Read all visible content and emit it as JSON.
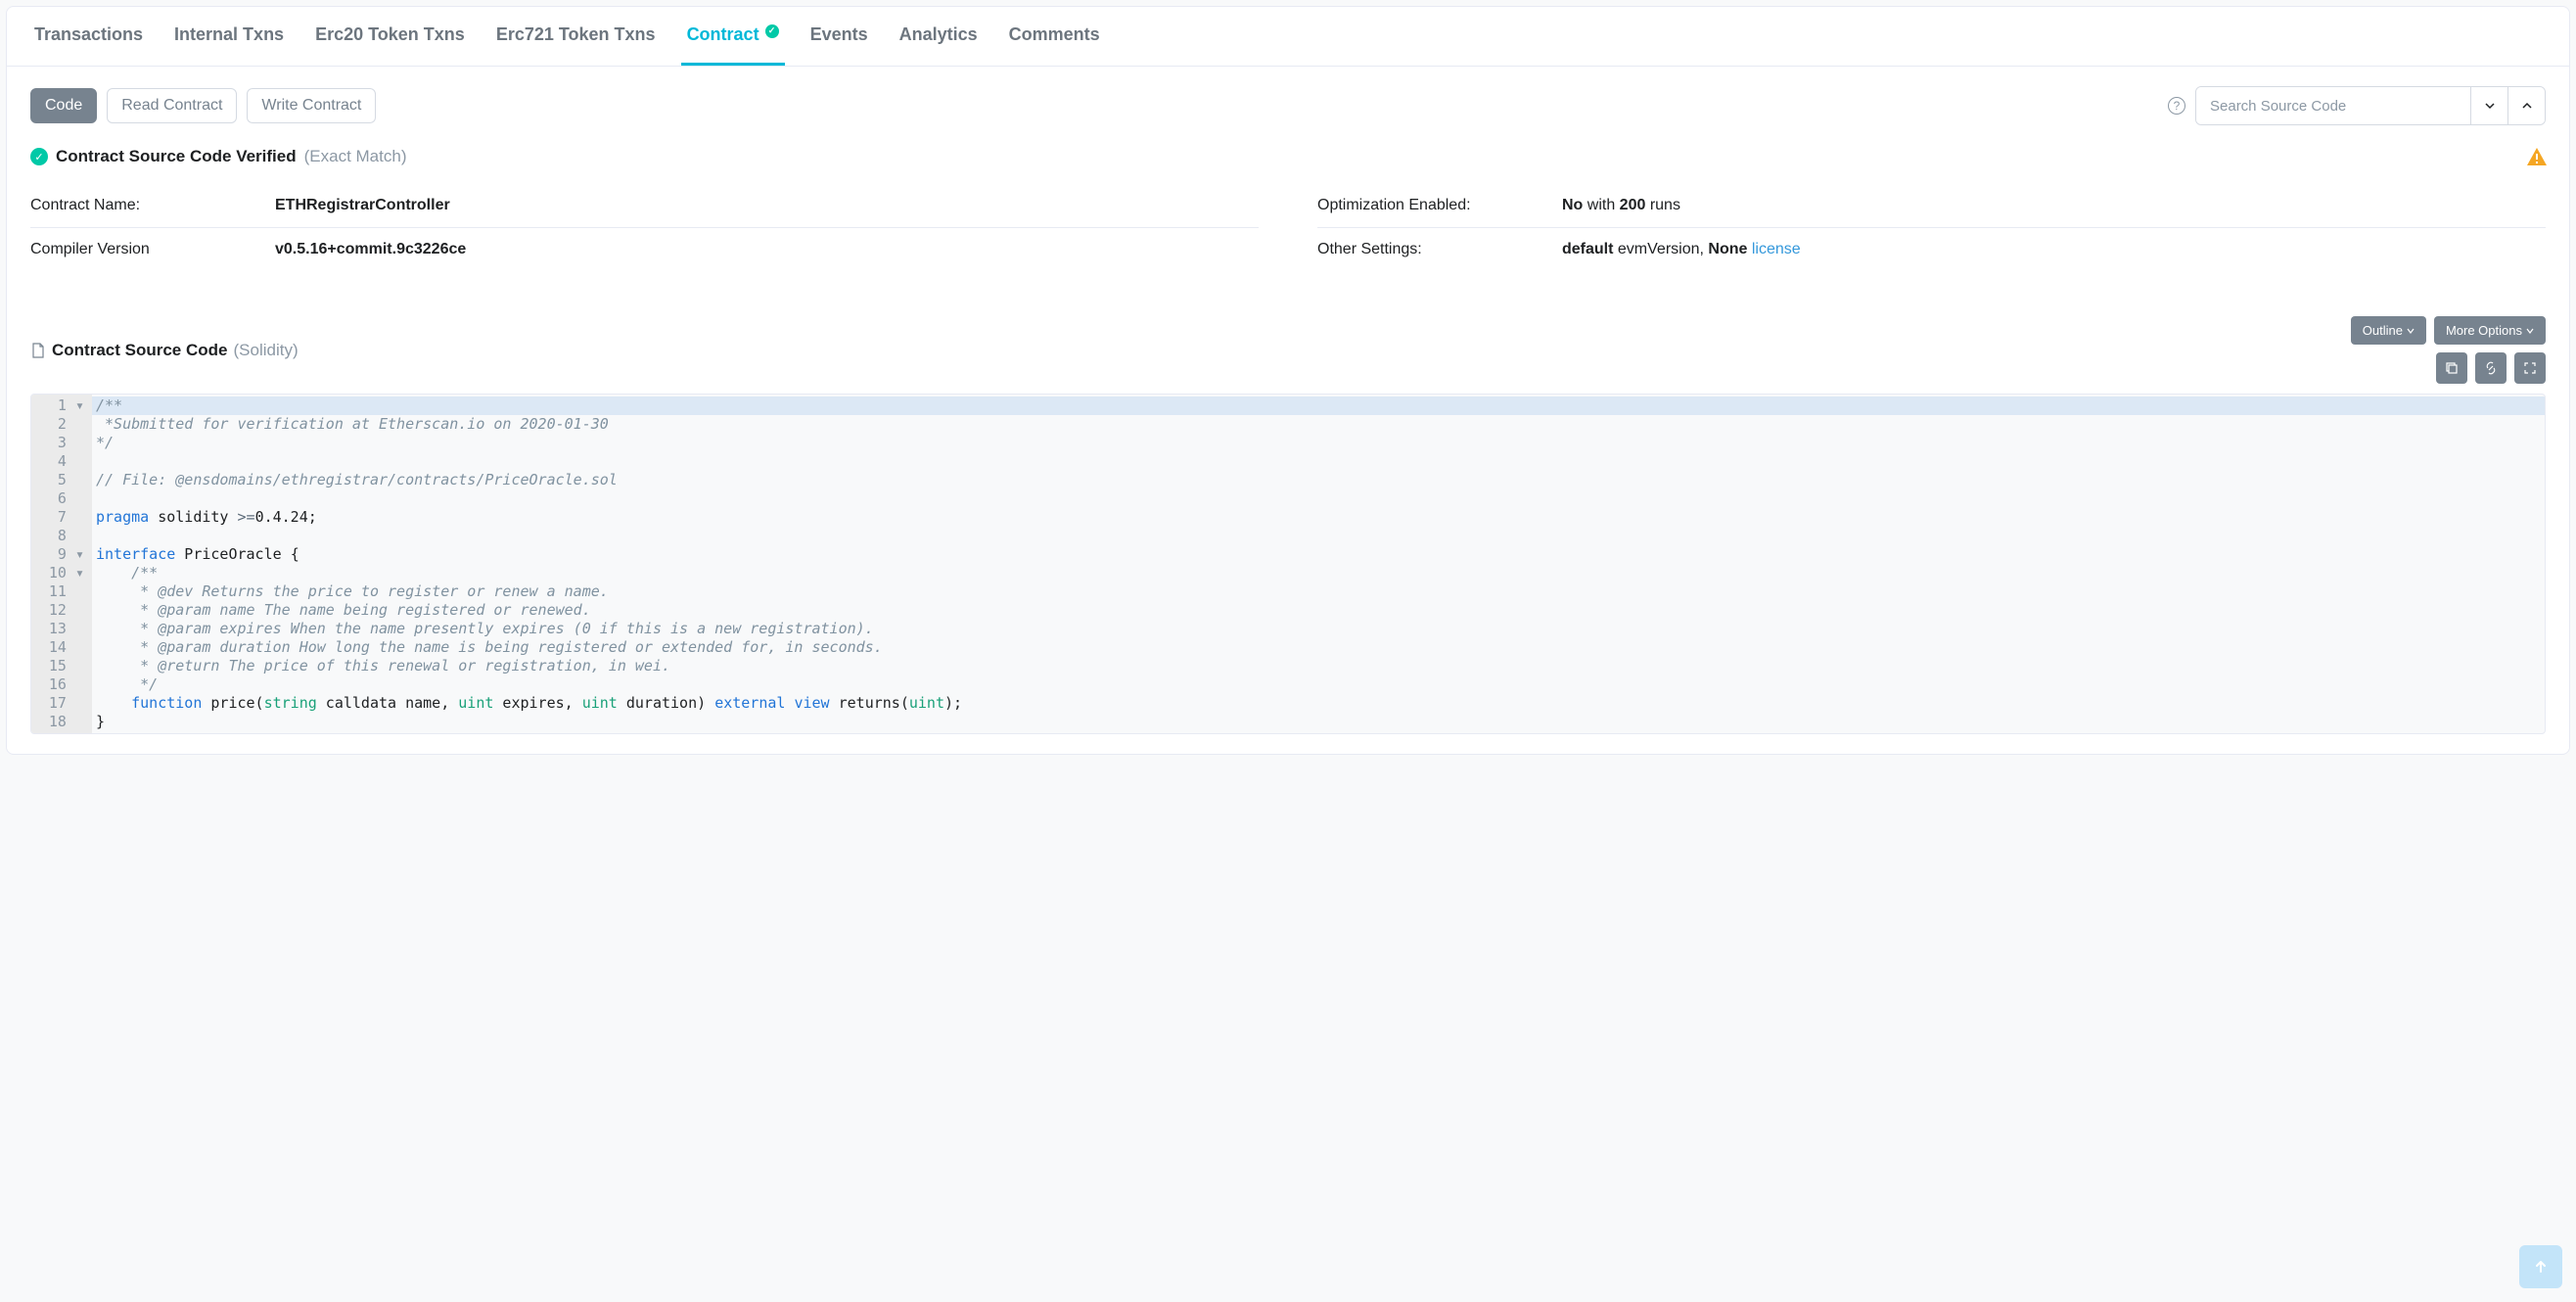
{
  "tabs": {
    "transactions": "Transactions",
    "internal": "Internal Txns",
    "erc20": "Erc20 Token Txns",
    "erc721": "Erc721 Token Txns",
    "contract": "Contract",
    "events": "Events",
    "analytics": "Analytics",
    "comments": "Comments"
  },
  "subtabs": {
    "code": "Code",
    "read": "Read Contract",
    "write": "Write Contract"
  },
  "search": {
    "placeholder": "Search Source Code"
  },
  "verified": {
    "title": "Contract Source Code Verified",
    "sub": "(Exact Match)"
  },
  "info": {
    "contract_name_label": "Contract Name:",
    "contract_name_value": "ETHRegistrarController",
    "compiler_label": "Compiler Version",
    "compiler_value": "v0.5.16+commit.9c3226ce",
    "optimization_label": "Optimization Enabled:",
    "optimization_prefix": "No",
    "optimization_mid": " with ",
    "optimization_runs": "200",
    "optimization_suffix": " runs",
    "other_label": "Other Settings:",
    "other_default": "default",
    "other_evm": " evmVersion, ",
    "other_none": "None",
    "other_license": "license"
  },
  "source": {
    "title": "Contract Source Code",
    "sub": "(Solidity)",
    "outline": "Outline",
    "more": "More Options"
  },
  "code": {
    "l1": "/**",
    "l2": " *Submitted for verification at Etherscan.io on 2020-01-30",
    "l3": "*/",
    "l4": "",
    "l5": "// File: @ensdomains/ethregistrar/contracts/PriceOracle.sol",
    "l6": "",
    "l7_a": "pragma",
    "l7_b": " solidity ",
    "l7_c": ">=",
    "l7_d": "0.4.24",
    "l7_e": ";",
    "l8": "",
    "l9_a": "interface",
    "l9_b": " PriceOracle ",
    "l9_c": "{",
    "l10": "    /**",
    "l11": "     * @dev Returns the price to register or renew a name.",
    "l12": "     * @param name The name being registered or renewed.",
    "l13": "     * @param expires When the name presently expires (0 if this is a new registration).",
    "l14": "     * @param duration How long the name is being registered or extended for, in seconds.",
    "l15": "     * @return The price of this renewal or registration, in wei.",
    "l16": "     */",
    "l17_a": "    ",
    "l17_b": "function",
    "l17_c": " price(",
    "l17_d": "string",
    "l17_e": " calldata name, ",
    "l17_f": "uint",
    "l17_g": " expires, ",
    "l17_h": "uint",
    "l17_i": " duration) ",
    "l17_j": "external",
    "l17_k": " ",
    "l17_l": "view",
    "l17_m": " returns(",
    "l17_n": "uint",
    "l17_o": ");",
    "l18": "}"
  },
  "gutter": " 1 ▾\n 2  \n 3  \n 4  \n 5  \n 6  \n 7  \n 8  \n 9 ▾\n10 ▾\n11  \n12  \n13  \n14  \n15  \n16  \n17  \n18  "
}
